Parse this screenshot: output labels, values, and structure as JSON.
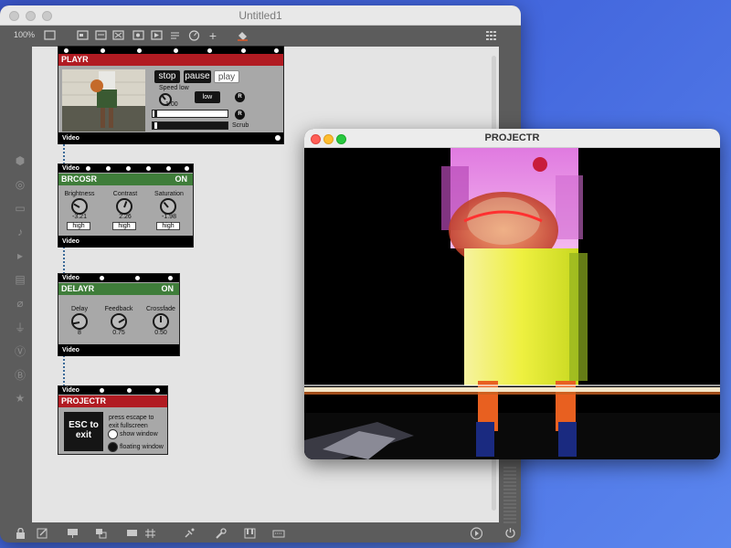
{
  "main_window": {
    "title": "Untitled1",
    "zoom": "100%"
  },
  "devices": {
    "playr": {
      "title": "PLAYR",
      "buttons": {
        "stop": "stop",
        "pause": "pause",
        "play": "play"
      },
      "speed_label": "Speed low",
      "speed_value": "1.00",
      "speed_mode": "low",
      "r_label": "R",
      "scrub_label": "Scrub",
      "footer": "Video"
    },
    "brcosr": {
      "top_label": "Video",
      "title": "BRCOSR",
      "status": "ON",
      "knobs": [
        {
          "label": "Brightness",
          "value": "-3.21",
          "button": "high"
        },
        {
          "label": "Contrast",
          "value": "2.26",
          "button": "high"
        },
        {
          "label": "Saturation",
          "value": "-1.98",
          "button": "high"
        }
      ],
      "footer": "Video"
    },
    "delayr": {
      "top_label": "Video",
      "title": "DELAYR",
      "status": "ON",
      "knobs": [
        {
          "label": "Delay",
          "value": "8"
        },
        {
          "label": "Feedback",
          "value": "0.75"
        },
        {
          "label": "Crossfade",
          "value": "0.50"
        }
      ],
      "footer": "Video"
    },
    "projectr": {
      "top_label": "Video",
      "title": "PROJECTR",
      "esc_button": "ESC to exit",
      "hint": "press escape to exit fullscreen",
      "options": [
        "show window",
        "floating window"
      ]
    }
  },
  "projector_window": {
    "title": "PROJECTR"
  },
  "colors": {
    "red_header": "#b11b22",
    "green_header": "#3f7d3a",
    "desktop": "#4468de"
  }
}
